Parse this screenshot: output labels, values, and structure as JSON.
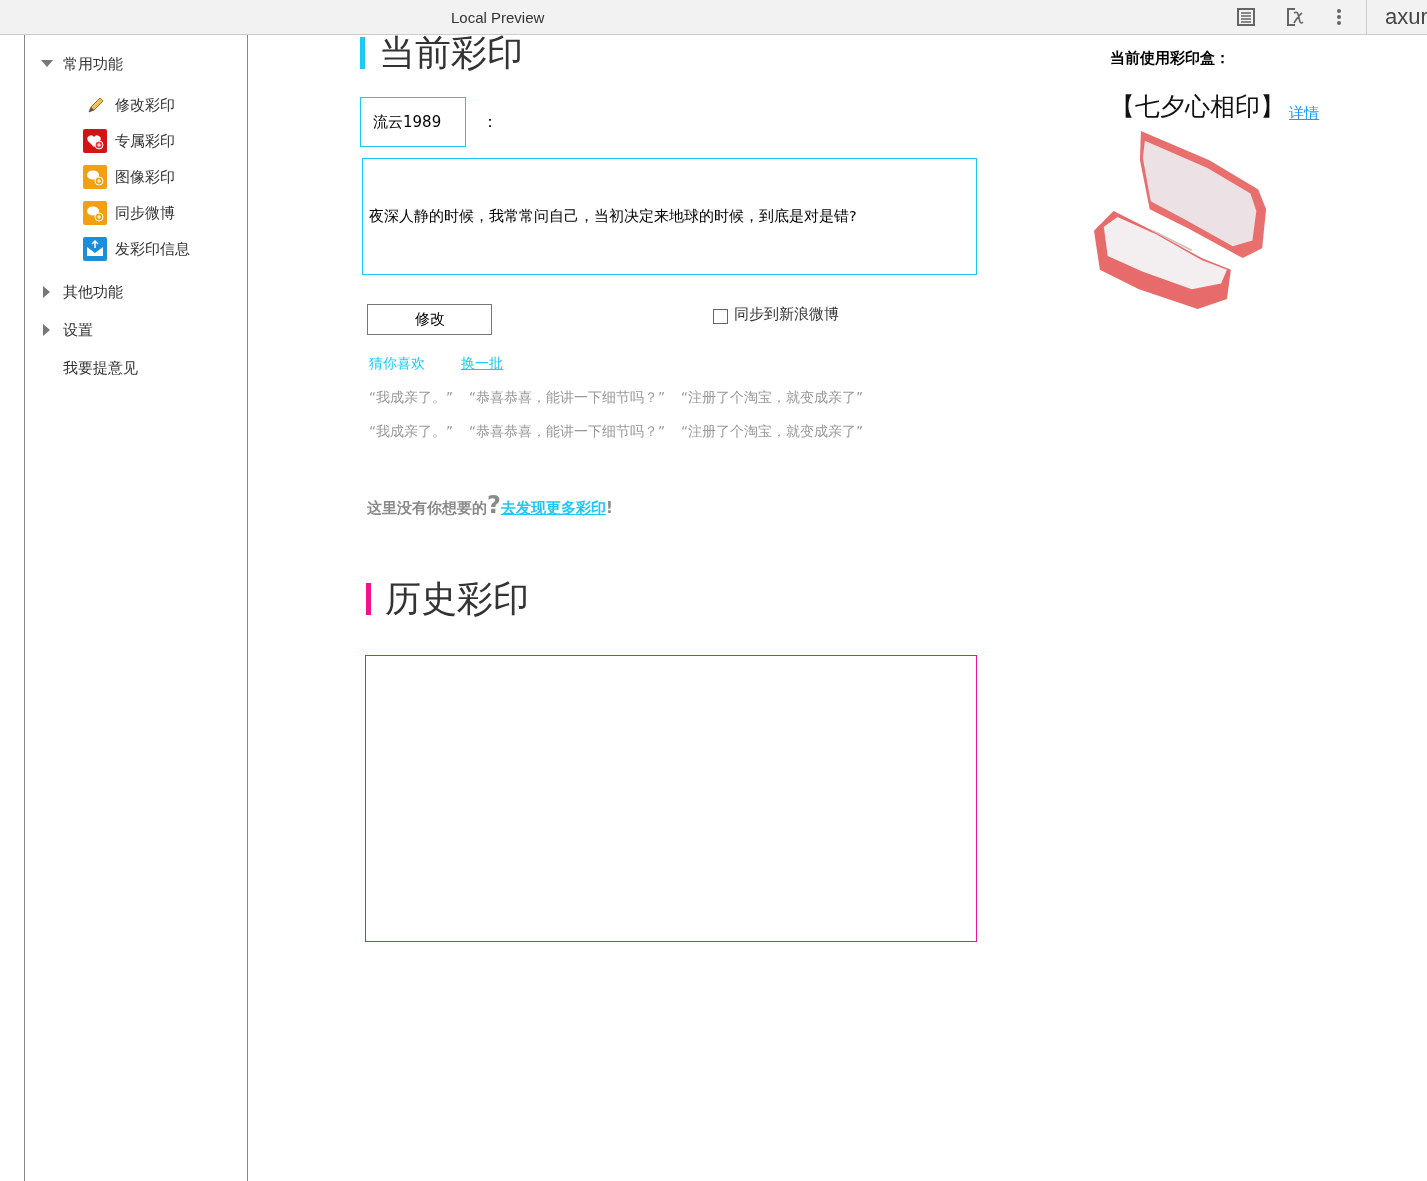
{
  "toolbar": {
    "title": "Local Preview",
    "logo": "axur"
  },
  "sidebar": {
    "items": [
      {
        "label": "常用功能",
        "expanded": true,
        "children": [
          {
            "label": "修改彩印"
          },
          {
            "label": "专属彩印"
          },
          {
            "label": "图像彩印"
          },
          {
            "label": "同步微博"
          },
          {
            "label": "发彩印信息"
          }
        ]
      },
      {
        "label": "其他功能",
        "expanded": false
      },
      {
        "label": "设置",
        "expanded": false
      },
      {
        "label": "我要提意见"
      }
    ]
  },
  "current": {
    "title": "当前彩印",
    "username": "流云1989",
    "separator": "：",
    "message": "夜深人静的时候，我常常问自己，当初决定来地球的时候，到底是对是错?",
    "edit_button": "修改",
    "sync": {
      "label": "同步到新浪微博",
      "checked": false
    },
    "suggestions": {
      "title": "猜你喜欢",
      "refresh_link": "换一批",
      "rows": [
        [
          "“我成亲了。”",
          "“恭喜恭喜，能讲一下细节吗？”",
          "“注册了个淘宝，就变成亲了”"
        ],
        [
          "“我成亲了。”",
          "“恭喜恭喜，能讲一下细节吗？”",
          "“注册了个淘宝，就变成亲了”"
        ]
      ]
    },
    "discover": {
      "prefix": "这里没有你想要的",
      "mark": "?",
      "link": "去发现更多彩印",
      "suffix": "!"
    }
  },
  "history": {
    "title": "历史彩印"
  },
  "box_panel": {
    "label": "当前使用彩印盒：",
    "name": "【七夕心相印】",
    "details_link": "详情"
  }
}
